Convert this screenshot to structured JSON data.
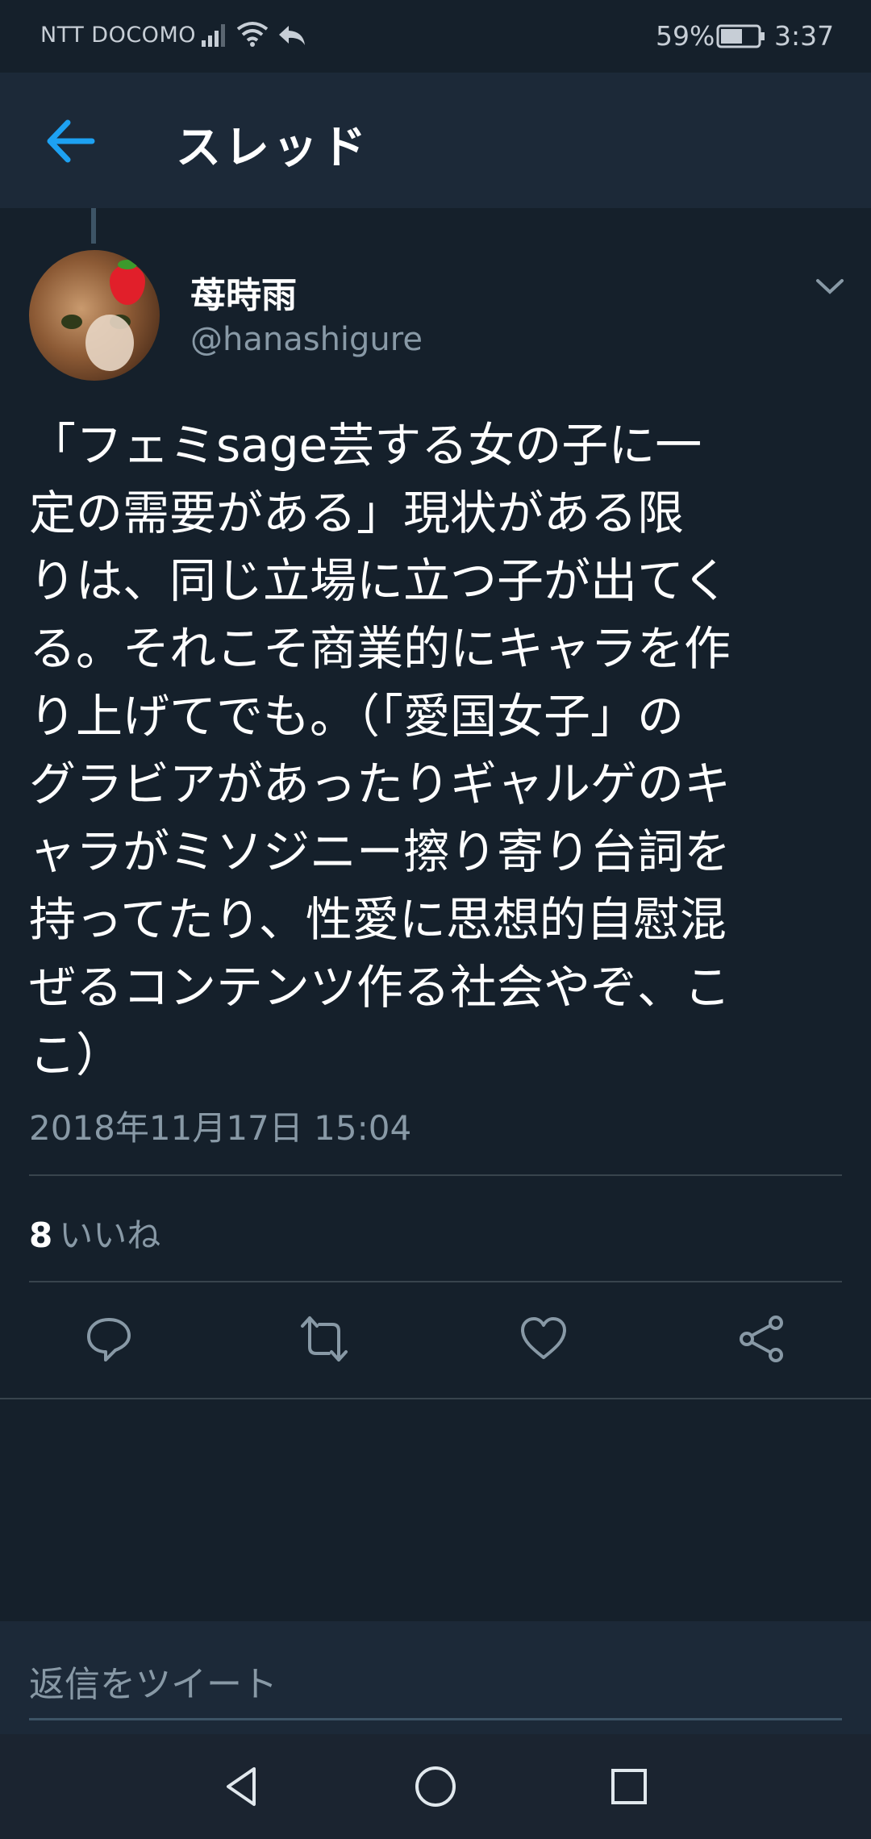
{
  "status_bar": {
    "carrier": "NTT DOCOMO",
    "battery_percent": "59%",
    "time": "3:37"
  },
  "header": {
    "title": "スレッド",
    "back_icon": "arrow-left-icon",
    "accent_color": "#1da1f2"
  },
  "tweet": {
    "author_name": "苺時雨",
    "author_handle": "@hanashigure",
    "text": "「フェミsage芸する女の子に一\n定の需要がある」現状がある限\nりは、同じ立場に立つ子が出てく\nる。それこそ商業的にキャラを作\nり上げてでも。（「愛国女子」の\nグラビアがあったりギャルゲのキ\nャラがミソジニー擦り寄り台詞を\n持ってたり、性愛に思想的自慰混\nぜるコンテンツ作る社会やぞ、こ\nこ）",
    "timestamp": "2018年11月17日 15:04",
    "likes_count": "8",
    "likes_label": "いいね"
  },
  "actions": {
    "icons": [
      "reply-icon",
      "retweet-icon",
      "like-icon",
      "share-icon"
    ]
  },
  "reply": {
    "placeholder": "返信をツイート"
  },
  "nav": {
    "icons": [
      "back-triangle-icon",
      "home-circle-icon",
      "recents-square-icon"
    ]
  }
}
